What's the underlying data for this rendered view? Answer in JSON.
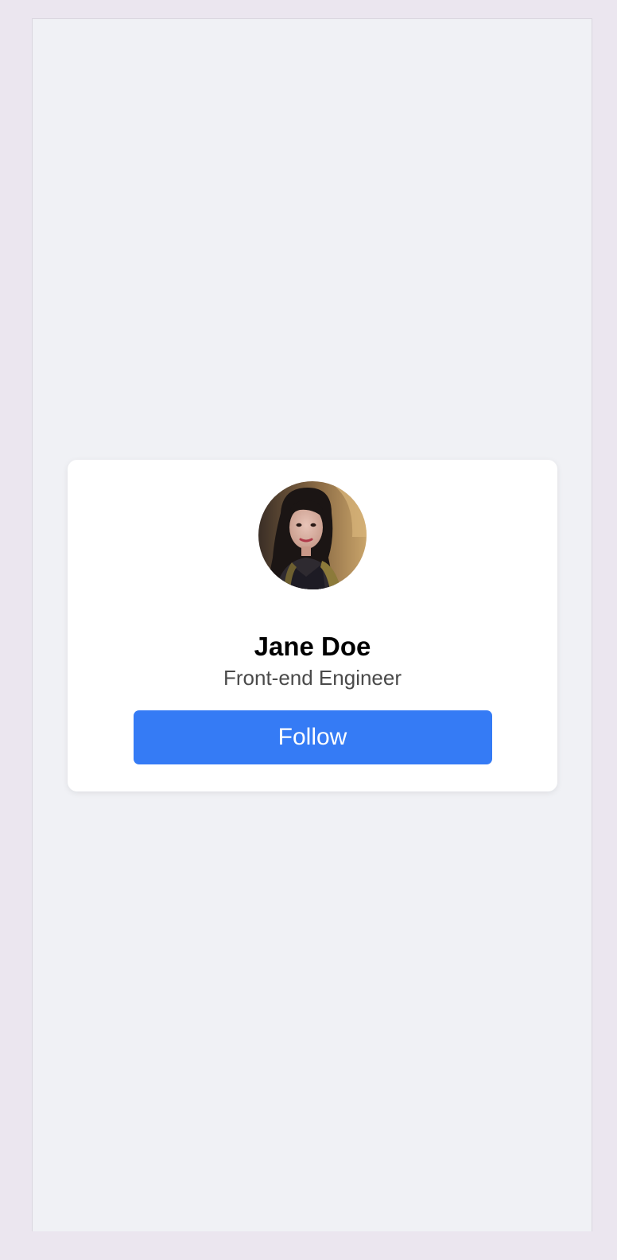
{
  "profile": {
    "name": "Jane Doe",
    "role": "Front-end Engineer",
    "avatar_icon": "user-avatar-photo"
  },
  "actions": {
    "follow_label": "Follow"
  },
  "colors": {
    "accent": "#357bf5",
    "page_background": "#f0f1f5",
    "card_background": "#ffffff"
  }
}
